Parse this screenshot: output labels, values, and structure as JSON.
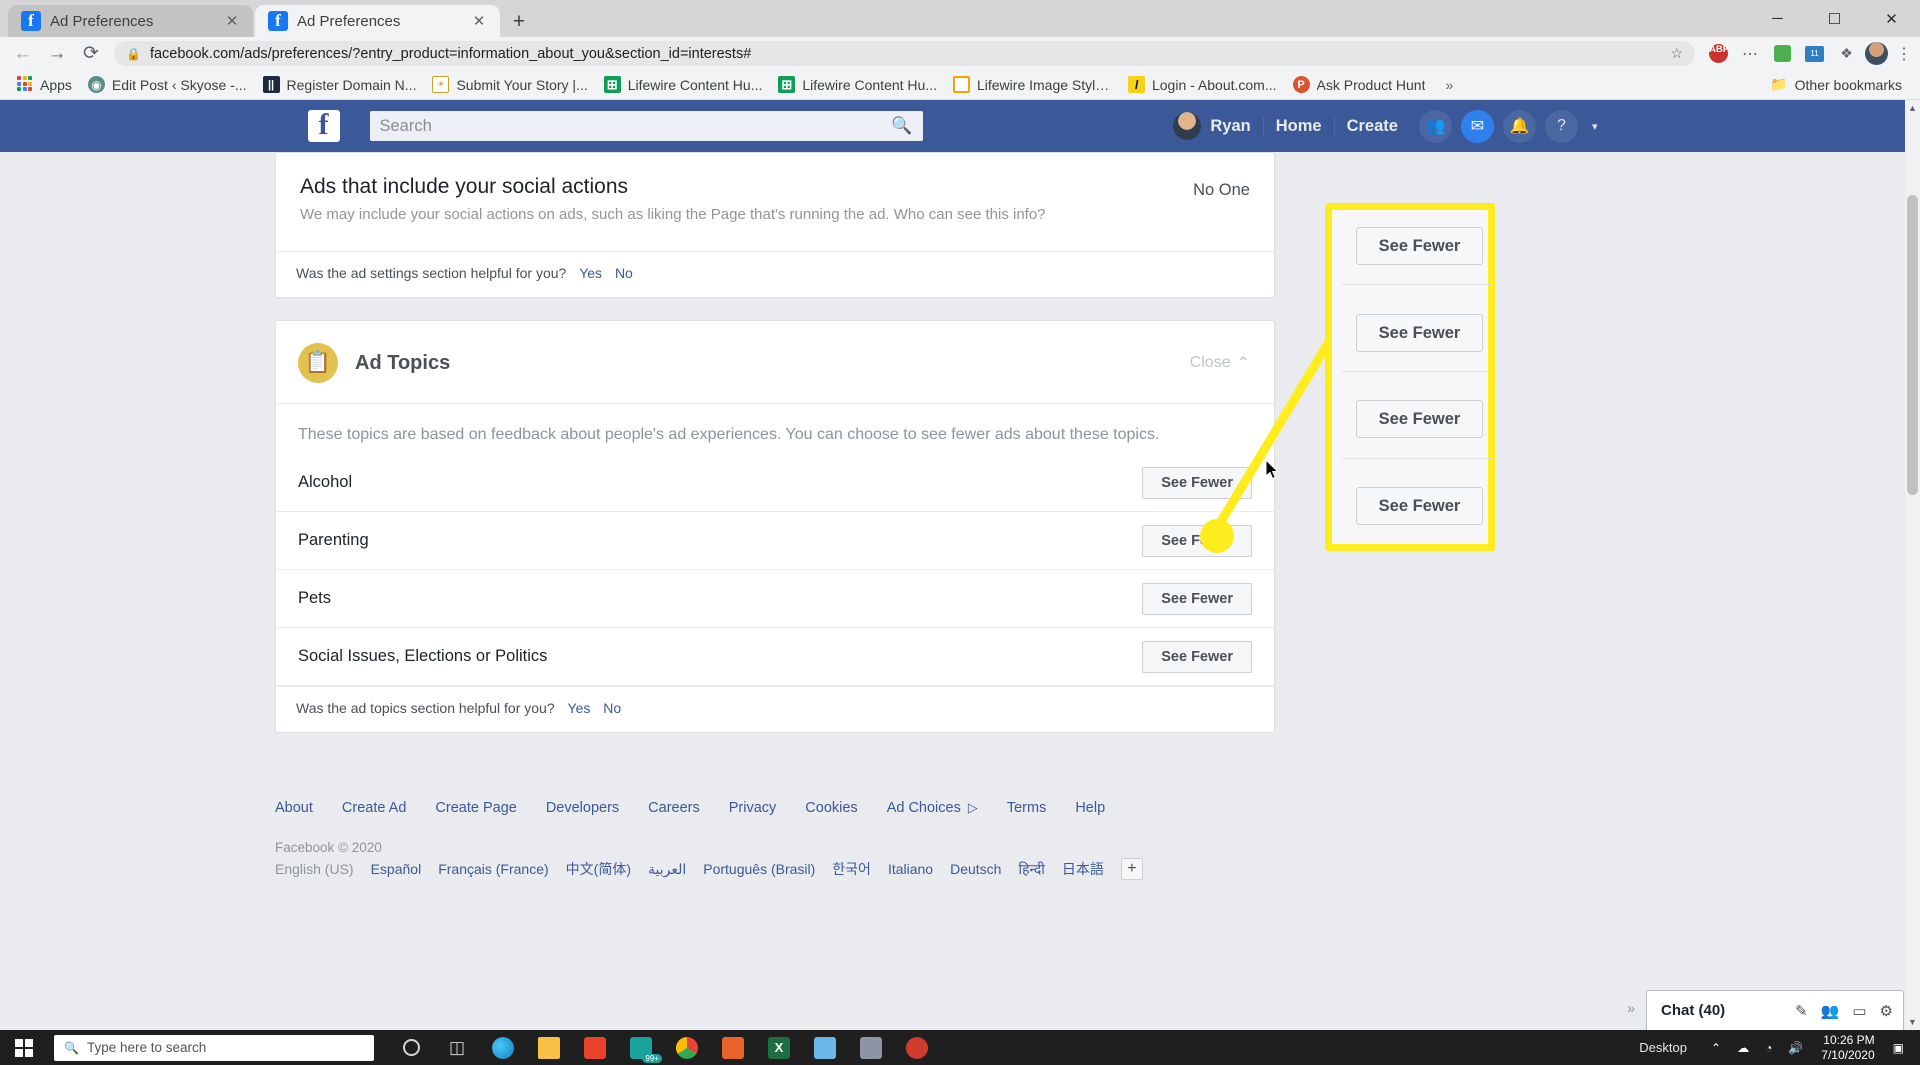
{
  "browser": {
    "tabs": [
      {
        "title": "Ad Preferences",
        "favicon": "facebook-icon",
        "active": false
      },
      {
        "title": "Ad Preferences",
        "favicon": "facebook-icon",
        "active": true
      }
    ],
    "new_tab_label": "+",
    "omnibox": {
      "url": "facebook.com/ads/preferences/?entry_product=information_about_you&section_id=interests#",
      "lock_icon": "lock-icon",
      "star_icon": "star-icon"
    },
    "nav": {
      "back": "←",
      "forward": "→",
      "reload": "⟳"
    },
    "window_controls": {
      "minimize": "─",
      "maximize": "☐",
      "close": "✕"
    },
    "extensions": [
      {
        "name": "adblock-plus-icon",
        "label": "ABP"
      },
      {
        "name": "extension-dots-icon",
        "label": "⋯"
      },
      {
        "name": "extension-green-icon",
        "label": ""
      },
      {
        "name": "extension-blue-icon",
        "label": "11"
      },
      {
        "name": "extension-puzzle-icon",
        "label": "❖"
      }
    ],
    "profile_icon": "profile-avatar-icon",
    "menu_icon": "kebab-menu-icon",
    "bookmarks": [
      {
        "label": "Apps",
        "icon": "apps-grid-icon"
      },
      {
        "label": "Edit Post ‹ Skyose -...",
        "icon": "globe-icon"
      },
      {
        "label": "Register Domain N...",
        "icon": "dark-square-icon"
      },
      {
        "label": "Submit Your Story |...",
        "icon": "yellow-doc-icon"
      },
      {
        "label": "Lifewire Content Hu...",
        "icon": "google-sheets-icon"
      },
      {
        "label": "Lifewire Content Hu...",
        "icon": "google-sheets-icon"
      },
      {
        "label": "Lifewire Image Style...",
        "icon": "orange-square-icon"
      },
      {
        "label": "Login - About.com...",
        "icon": "yellow-l-icon"
      },
      {
        "label": "Ask Product Hunt",
        "icon": "product-hunt-icon"
      }
    ],
    "bookmarks_overflow": "»",
    "other_bookmarks": {
      "label": "Other bookmarks",
      "icon": "folder-icon"
    }
  },
  "facebook_nav": {
    "logo": "f",
    "search_placeholder": "Search",
    "search_icon": "search-icon",
    "profile_name": "Ryan",
    "links": [
      "Home",
      "Create"
    ],
    "icons": [
      {
        "name": "friend-requests-icon",
        "glyph": "👥"
      },
      {
        "name": "messenger-icon",
        "glyph": "✉"
      },
      {
        "name": "notifications-icon",
        "glyph": "🔔"
      },
      {
        "name": "help-icon",
        "glyph": "?"
      }
    ],
    "caret": "▾"
  },
  "ad_settings": {
    "row": {
      "title": "Ads that include your social actions",
      "description": "We may include your social actions on ads, such as liking the Page that's running the ad. Who can see this info?",
      "value": "No One"
    },
    "helpful_question": "Was the ad settings section helpful for you?",
    "yes": "Yes",
    "no": "No"
  },
  "ad_topics": {
    "icon": "ad-topics-icon",
    "title": "Ad Topics",
    "close_label": "Close",
    "close_caret": "⌃",
    "intro": "These topics are based on feedback about people's ad experiences. You can choose to see fewer ads about these topics.",
    "button_label": "See Fewer",
    "topics": [
      {
        "name": "Alcohol"
      },
      {
        "name": "Parenting"
      },
      {
        "name": "Pets"
      },
      {
        "name": "Social Issues, Elections or Politics"
      }
    ],
    "helpful_question": "Was the ad topics section helpful for you?",
    "yes": "Yes",
    "no": "No"
  },
  "footer": {
    "links": [
      "About",
      "Create Ad",
      "Create Page",
      "Developers",
      "Careers",
      "Privacy",
      "Cookies",
      "Ad Choices",
      "Terms",
      "Help"
    ],
    "adchoices_glyph": "▷",
    "copyright": "Facebook © 2020",
    "languages": [
      "English (US)",
      "Español",
      "Français (France)",
      "中文(简体)",
      "العربية",
      "Português (Brasil)",
      "한국어",
      "Italiano",
      "Deutsch",
      "हिन्दी",
      "日本語"
    ],
    "add_language": "+"
  },
  "chat_dock": {
    "label": "Chat (40)",
    "icons": [
      {
        "name": "compose-icon",
        "glyph": "✎"
      },
      {
        "name": "friends-icon",
        "glyph": "👥"
      },
      {
        "name": "video-icon",
        "glyph": "▭"
      },
      {
        "name": "settings-gear-icon",
        "glyph": "⚙"
      }
    ],
    "expand_chevrons": "»"
  },
  "annotation": {
    "highlight_color": "#ffec1f",
    "callout_buttons": [
      "See Fewer",
      "See Fewer",
      "See Fewer",
      "See Fewer"
    ]
  },
  "taskbar": {
    "start_icon": "windows-start-icon",
    "search_placeholder": "Type here to search",
    "search_icon": "search-icon",
    "apps": [
      {
        "name": "cortana-icon",
        "color": "#d4d4d4"
      },
      {
        "name": "task-view-icon",
        "color": "#d4d4d4"
      },
      {
        "name": "microsoft-edge-icon",
        "color": "#1b9ae0"
      },
      {
        "name": "file-explorer-icon",
        "color": "#f7c244"
      },
      {
        "name": "microsoft-store-icon",
        "color": "#e8422b"
      },
      {
        "name": "app-teal-icon",
        "color": "#1aa39b"
      },
      {
        "name": "google-chrome-icon",
        "color": "#34a853"
      },
      {
        "name": "app-orange-icon",
        "color": "#e8622b"
      },
      {
        "name": "microsoft-excel-icon",
        "color": "#1d6f42"
      },
      {
        "name": "app-lightblue-icon",
        "color": "#6ab7e8"
      },
      {
        "name": "app-gray-icon",
        "color": "#8b95a3"
      },
      {
        "name": "app-red-icon",
        "color": "#d03b2f"
      }
    ],
    "badge_99": "99+",
    "desktop_label": "Desktop",
    "tray_icons": [
      {
        "name": "show-hidden-icons",
        "glyph": "⌃"
      },
      {
        "name": "onedrive-icon",
        "glyph": "☁"
      },
      {
        "name": "network-icon",
        "glyph": "◔"
      },
      {
        "name": "volume-icon",
        "glyph": "🔊"
      },
      {
        "name": "action-center-icon",
        "glyph": "▣"
      }
    ],
    "time": "10:26 PM",
    "date": "7/10/2020"
  }
}
